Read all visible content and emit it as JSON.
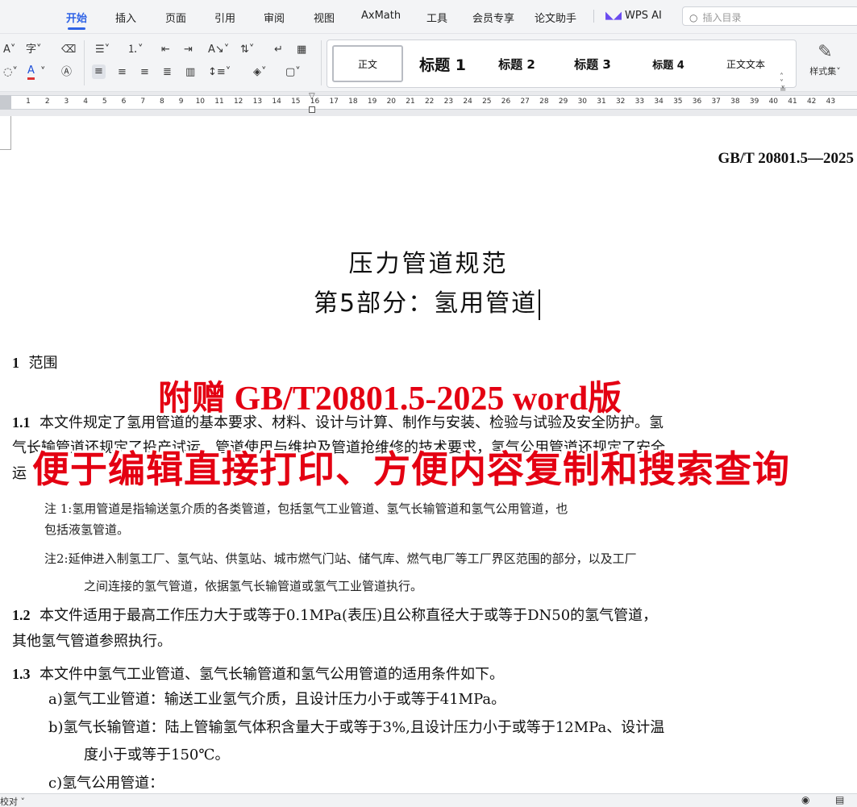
{
  "menu": {
    "tabs": [
      "开始",
      "插入",
      "页面",
      "引用",
      "审阅",
      "视图",
      "AxMath",
      "工具",
      "会员专享",
      "论文助手"
    ],
    "wps_ai": "WPS AI",
    "search_placeholder": "插入目录"
  },
  "ribbon": {
    "styles": [
      "正文",
      "标题 1",
      "标题 2",
      "标题 3",
      "标题 4",
      "正文文本"
    ],
    "style_set_label": "样式集"
  },
  "ruler": {
    "numbers": [
      "1",
      "2",
      "3",
      "4",
      "5",
      "6",
      "7",
      "8",
      "9",
      "10",
      "11",
      "12",
      "13",
      "14",
      "15",
      "16",
      "17",
      "18",
      "19",
      "20",
      "21",
      "22",
      "23",
      "24",
      "25",
      "26",
      "27",
      "28",
      "29",
      "30",
      "31",
      "32",
      "33",
      "34",
      "35",
      "36",
      "37",
      "38",
      "39",
      "40",
      "41",
      "42",
      "43"
    ]
  },
  "document": {
    "std_code": "GB/T 20801.5—2025",
    "title_line1": "压力管道规范",
    "title_line2": "第5部分：氢用管道",
    "section1": {
      "num": "1",
      "text": "范围"
    },
    "p1_1": {
      "num": "1.1",
      "line1": "本文件规定了氢用管道的基本要求、材料、设计与计算、制作与安装、检验与试验及安全防护。氢",
      "line2": "气长输管道还规定了投产试运、管道使用与维护及管道抢维修的技术要求，氢气公用管道还规定了安全",
      "line3": "运"
    },
    "note1": {
      "label": "注 1:",
      "line1": "氢用管道是指输送氢介质的各类管道，包括氢气工业管道、氢气长输管道和氢气公用管道，也",
      "line2": "包括液氢管道。"
    },
    "note2": {
      "label": "注2:",
      "line1": "延伸进入制氢工厂、氢气站、供氢站、城市燃气门站、储气库、燃气电厂等工厂界区范围的部分，以及工厂",
      "line2": "之间连接的氢气管道，依据氢气长输管道或氢气工业管道执行。"
    },
    "p1_2": {
      "num": "1.2",
      "line1": "本文件适用于最高工作压力大于或等于0.1MPa(表压)且公称直径大于或等于DN50的氢气管道，",
      "line2": "其他氢气管道参照执行。"
    },
    "p1_3": {
      "num": "1.3",
      "line1": "本文件中氢气工业管道、氢气长输管道和氢气公用管道的适用条件如下。"
    },
    "item_a": "a)氢气工业管道：输送工业氢气介质，且设计压力小于或等于41MPa。",
    "item_b_line1": "b)氢气长输管道：陆上管输氢气体积含量大于或等于3%,且设计压力小于或等于12MPa、设计温",
    "item_b_line2": "度小于或等于150℃。",
    "item_c": "c)氢气公用管道："
  },
  "overlay": {
    "line1": "附赠 GB/T20801.5-2025 word版",
    "line2": "便于编辑直接打印、方便内容复制和搜索查询"
  },
  "statusbar": {
    "left": "校对"
  }
}
